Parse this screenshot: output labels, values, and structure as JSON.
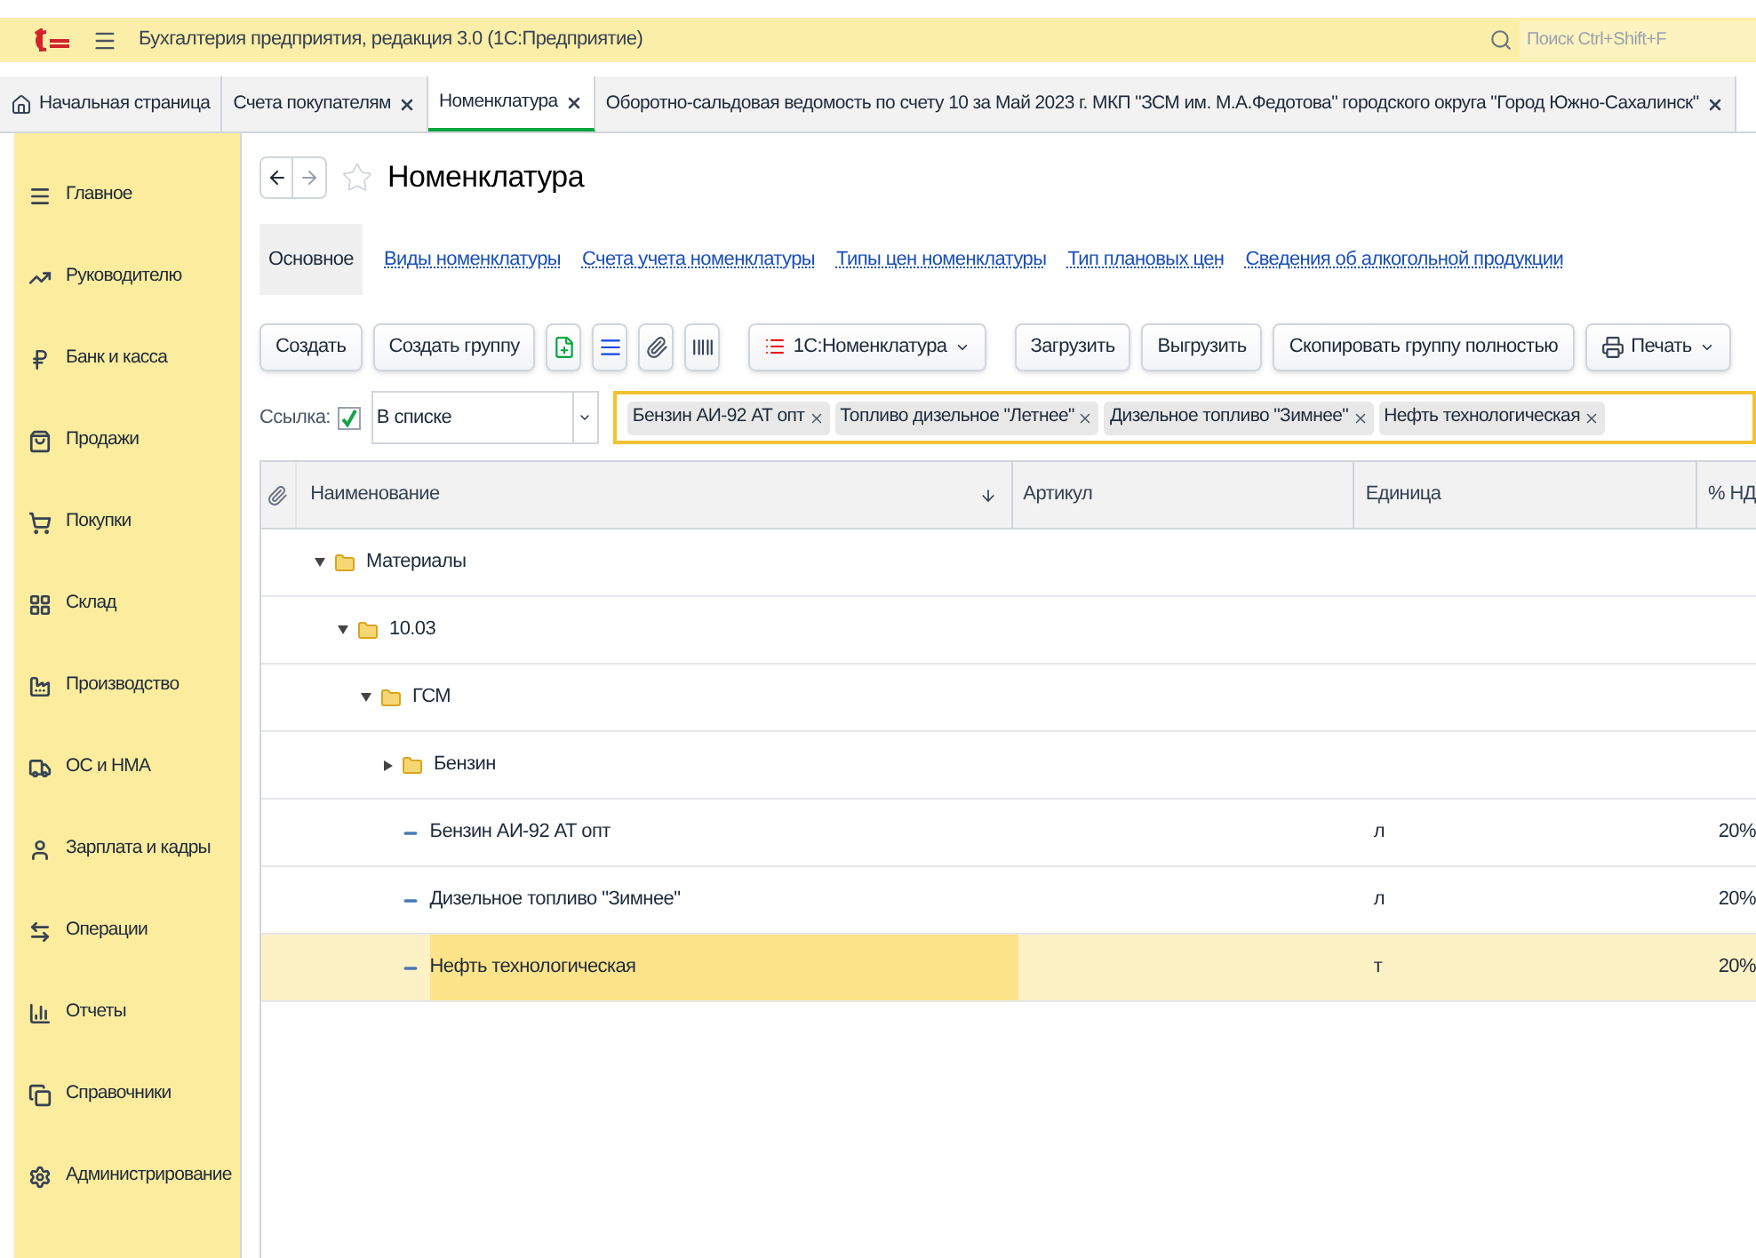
{
  "window": {
    "title": "Бухгалтерия предприятия, редакция 3.0  (1С:Предприятие)",
    "search_placeholder": "Поиск Ctrl+Shift+F"
  },
  "tabs": [
    {
      "label": "Начальная страница",
      "selected": false,
      "closable": false
    },
    {
      "label": "Счета покупателям",
      "selected": false,
      "closable": true
    },
    {
      "label": "Номенклатура",
      "selected": true,
      "closable": true
    },
    {
      "label": "Оборотно-сальдовая ведомость по счету 10 за Май 2023 г. МКП \"ЗСМ им. М.А.Федотова\" городского округа \"Город Южно-Сахалинск\"",
      "selected": false,
      "closable": true
    }
  ],
  "sidebar": {
    "items": [
      {
        "label": "Главное"
      },
      {
        "label": "Руководителю"
      },
      {
        "label": "Банк и касса"
      },
      {
        "label": "Продажи"
      },
      {
        "label": "Покупки"
      },
      {
        "label": "Склад"
      },
      {
        "label": "Производство"
      },
      {
        "label": "ОС и НМА"
      },
      {
        "label": "Зарплата и кадры"
      },
      {
        "label": "Операции"
      },
      {
        "label": "Отчеты"
      },
      {
        "label": "Справочники"
      },
      {
        "label": "Администрирование"
      }
    ]
  },
  "page": {
    "title": "Номенклатура",
    "nav": [
      {
        "label": "Основное",
        "selected": true
      },
      {
        "label": "Виды номенклатуры",
        "selected": false
      },
      {
        "label": "Счета учета номенклатуры",
        "selected": false
      },
      {
        "label": "Типы цен номенклатуры",
        "selected": false
      },
      {
        "label": "Тип плановых цен",
        "selected": false
      },
      {
        "label": "Сведения об алкогольной продукции",
        "selected": false
      }
    ],
    "toolbar": [
      {
        "kind": "text",
        "label": "Создать"
      },
      {
        "kind": "text",
        "label": "Создать группу"
      },
      {
        "kind": "icon"
      },
      {
        "kind": "icon"
      },
      {
        "kind": "icon"
      },
      {
        "kind": "icon"
      },
      {
        "kind": "menu",
        "label": "1С:Номенклатура"
      },
      {
        "kind": "text",
        "label": "Загрузить"
      },
      {
        "kind": "text",
        "label": "Выгрузить"
      },
      {
        "kind": "text",
        "label": "Скопировать группу полностью"
      },
      {
        "kind": "print",
        "label": "Печать"
      }
    ],
    "filter": {
      "label": "Ссылка:",
      "checked": true,
      "mode": "В списке",
      "values": [
        "Бензин АИ-92 АТ опт",
        "Топливо дизельное \"Летнее\"",
        "Дизельное топливо \"Зимнее\"",
        "Нефть технологическая"
      ]
    },
    "table": {
      "columns": [
        "Наименование",
        "Артикул",
        "Единица",
        "% НД"
      ],
      "rows": [
        {
          "kind": "group",
          "name": "Материалы",
          "expanded": true,
          "selected": false,
          "children": [
            {
              "kind": "group",
              "name": "10.03",
              "expanded": true,
              "selected": false,
              "children": [
                {
                  "kind": "group",
                  "name": "ГСМ",
                  "expanded": true,
                  "selected": false,
                  "children": [
                    {
                      "kind": "group",
                      "name": "Бензин",
                      "expanded": false,
                      "selected": false
                    },
                    {
                      "kind": "item",
                      "name": "Бензин АИ-92 АТ опт",
                      "unit": "л",
                      "vat": "20%",
                      "selected": false
                    },
                    {
                      "kind": "item",
                      "name": "Дизельное топливо \"Зимнее\"",
                      "unit": "л",
                      "vat": "20%",
                      "selected": false
                    },
                    {
                      "kind": "item",
                      "name": "Нефть технологическая",
                      "unit": "т",
                      "vat": "20%",
                      "selected": true
                    }
                  ]
                }
              ]
            }
          ]
        }
      ]
    }
  }
}
